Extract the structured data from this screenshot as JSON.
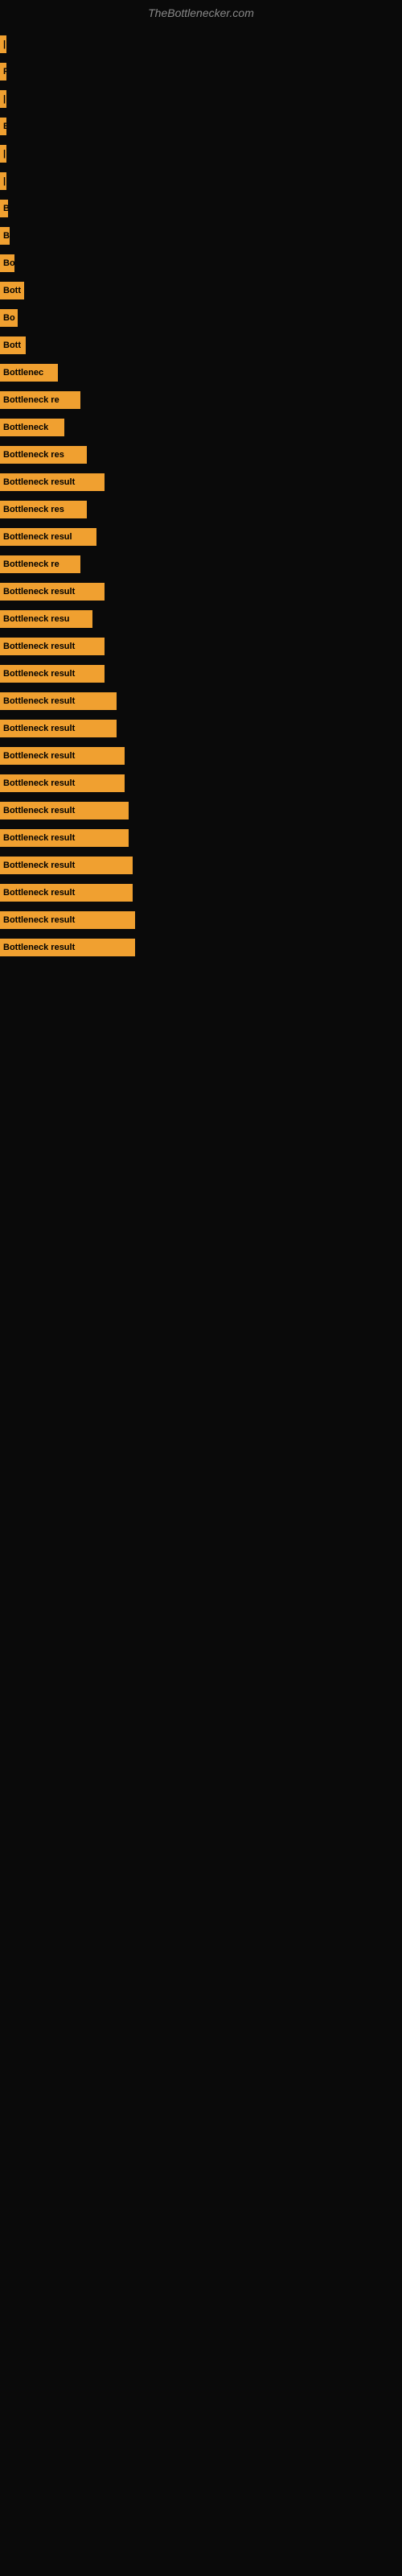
{
  "site": {
    "title": "TheBottlenecker.com"
  },
  "bars": [
    {
      "label": "|",
      "width": 4
    },
    {
      "label": "F",
      "width": 6
    },
    {
      "label": "|",
      "width": 6
    },
    {
      "label": "B",
      "width": 8
    },
    {
      "label": "|",
      "width": 8
    },
    {
      "label": "|",
      "width": 8
    },
    {
      "label": "B",
      "width": 10
    },
    {
      "label": "B",
      "width": 12
    },
    {
      "label": "Bo",
      "width": 18
    },
    {
      "label": "Bott",
      "width": 30
    },
    {
      "label": "Bo",
      "width": 22
    },
    {
      "label": "Bott",
      "width": 32
    },
    {
      "label": "Bottlenec",
      "width": 72
    },
    {
      "label": "Bottleneck re",
      "width": 100
    },
    {
      "label": "Bottleneck",
      "width": 80
    },
    {
      "label": "Bottleneck res",
      "width": 108
    },
    {
      "label": "Bottleneck result",
      "width": 130
    },
    {
      "label": "Bottleneck res",
      "width": 108
    },
    {
      "label": "Bottleneck resul",
      "width": 120
    },
    {
      "label": "Bottleneck re",
      "width": 100
    },
    {
      "label": "Bottleneck result",
      "width": 130
    },
    {
      "label": "Bottleneck resu",
      "width": 115
    },
    {
      "label": "Bottleneck result",
      "width": 130
    },
    {
      "label": "Bottleneck result",
      "width": 130
    },
    {
      "label": "Bottleneck result",
      "width": 145
    },
    {
      "label": "Bottleneck result",
      "width": 145
    },
    {
      "label": "Bottleneck result",
      "width": 155
    },
    {
      "label": "Bottleneck result",
      "width": 155
    },
    {
      "label": "Bottleneck result",
      "width": 160
    },
    {
      "label": "Bottleneck result",
      "width": 160
    },
    {
      "label": "Bottleneck result",
      "width": 165
    },
    {
      "label": "Bottleneck result",
      "width": 165
    },
    {
      "label": "Bottleneck result",
      "width": 168
    },
    {
      "label": "Bottleneck result",
      "width": 168
    }
  ]
}
